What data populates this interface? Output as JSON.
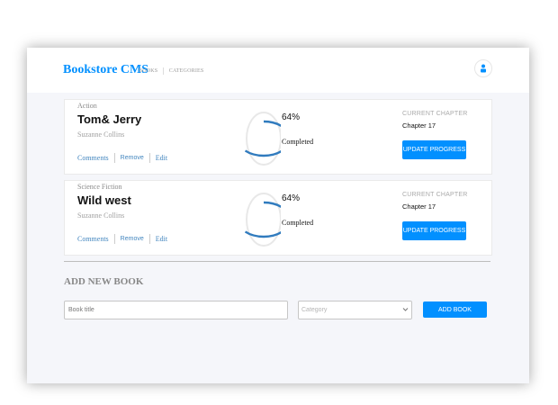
{
  "header": {
    "logo": "Bookstore CMS",
    "nav": [
      "BOOKS",
      "CATEGORIES"
    ]
  },
  "books": [
    {
      "genre": "Action",
      "title": "Tom& Jerry",
      "author": "Suzanne Collins",
      "actions": [
        "Comments",
        "Remove",
        "Edit"
      ],
      "percent_label": "64%",
      "percent_value": 64,
      "completed_label": "Completed",
      "chapter_label": "CURRENT CHAPTER",
      "chapter_value": "Chapter 17",
      "update_label": "UPDATE PROGRESS"
    },
    {
      "genre": "Science Fiction",
      "title": "Wild west",
      "author": "Suzanne Collins",
      "actions": [
        "Comments",
        "Remove",
        "Edit"
      ],
      "percent_label": "64%",
      "percent_value": 64,
      "completed_label": "Completed",
      "chapter_label": "CURRENT CHAPTER",
      "chapter_value": "Chapter 17",
      "update_label": "UPDATE PROGRESS"
    }
  ],
  "add_form": {
    "title": "ADD NEW BOOK",
    "title_placeholder": "Book title",
    "category_placeholder": "Category",
    "add_label": "ADD BOOK"
  },
  "colors": {
    "accent": "#0290ff",
    "progress": "#307bbe",
    "progress_track": "#e8e8e8"
  },
  "icons": {
    "avatar": "user-icon",
    "select": "chevron-down-icon"
  }
}
